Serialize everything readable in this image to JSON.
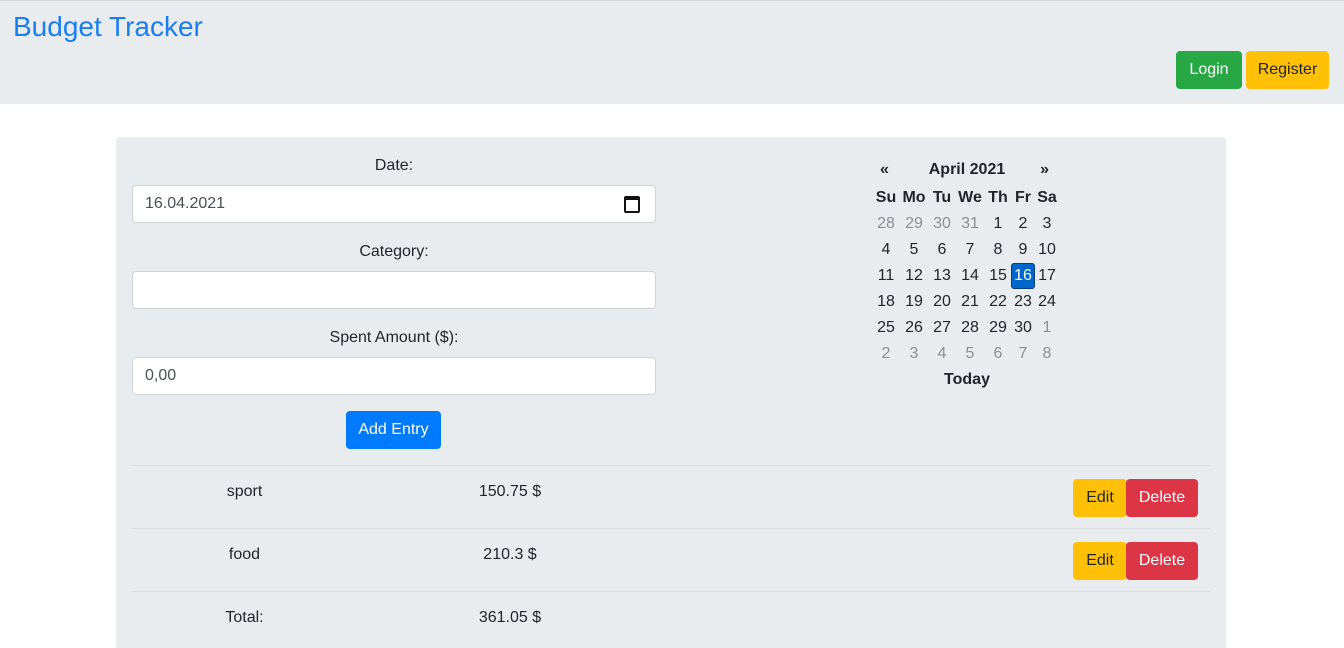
{
  "brand": "Budget Tracker",
  "nav": {
    "login": "Login",
    "register": "Register"
  },
  "form": {
    "date_label": "Date:",
    "date_value": "16.04.2021",
    "category_label": "Category:",
    "category_value": "",
    "amount_label": "Spent Amount ($):",
    "amount_value": "0,00",
    "add_button": "Add Entry"
  },
  "calendar": {
    "prev": "«",
    "title": "April 2021",
    "next": "»",
    "weekdays": [
      "Su",
      "Mo",
      "Tu",
      "We",
      "Th",
      "Fr",
      "Sa"
    ],
    "weeks": [
      [
        "28",
        "29",
        "30",
        "31",
        "1",
        "2",
        "3"
      ],
      [
        "4",
        "5",
        "6",
        "7",
        "8",
        "9",
        "10"
      ],
      [
        "11",
        "12",
        "13",
        "14",
        "15",
        "16",
        "17"
      ],
      [
        "18",
        "19",
        "20",
        "21",
        "22",
        "23",
        "24"
      ],
      [
        "25",
        "26",
        "27",
        "28",
        "29",
        "30",
        "1"
      ],
      [
        "2",
        "3",
        "4",
        "5",
        "6",
        "7",
        "8"
      ]
    ],
    "selected_day": "16",
    "today_label": "Today"
  },
  "entries": [
    {
      "category": "sport",
      "amount": "150.75 $",
      "edit": "Edit",
      "delete": "Delete"
    },
    {
      "category": "food",
      "amount": "210.3 $",
      "edit": "Edit",
      "delete": "Delete"
    }
  ],
  "total": {
    "label": "Total:",
    "amount": "361.05 $"
  },
  "colors": {
    "brand": "#1a7ef0",
    "success": "#28a745",
    "warning": "#ffc107",
    "primary": "#007bff",
    "danger": "#dc3545",
    "panel": "#e9ecef"
  }
}
